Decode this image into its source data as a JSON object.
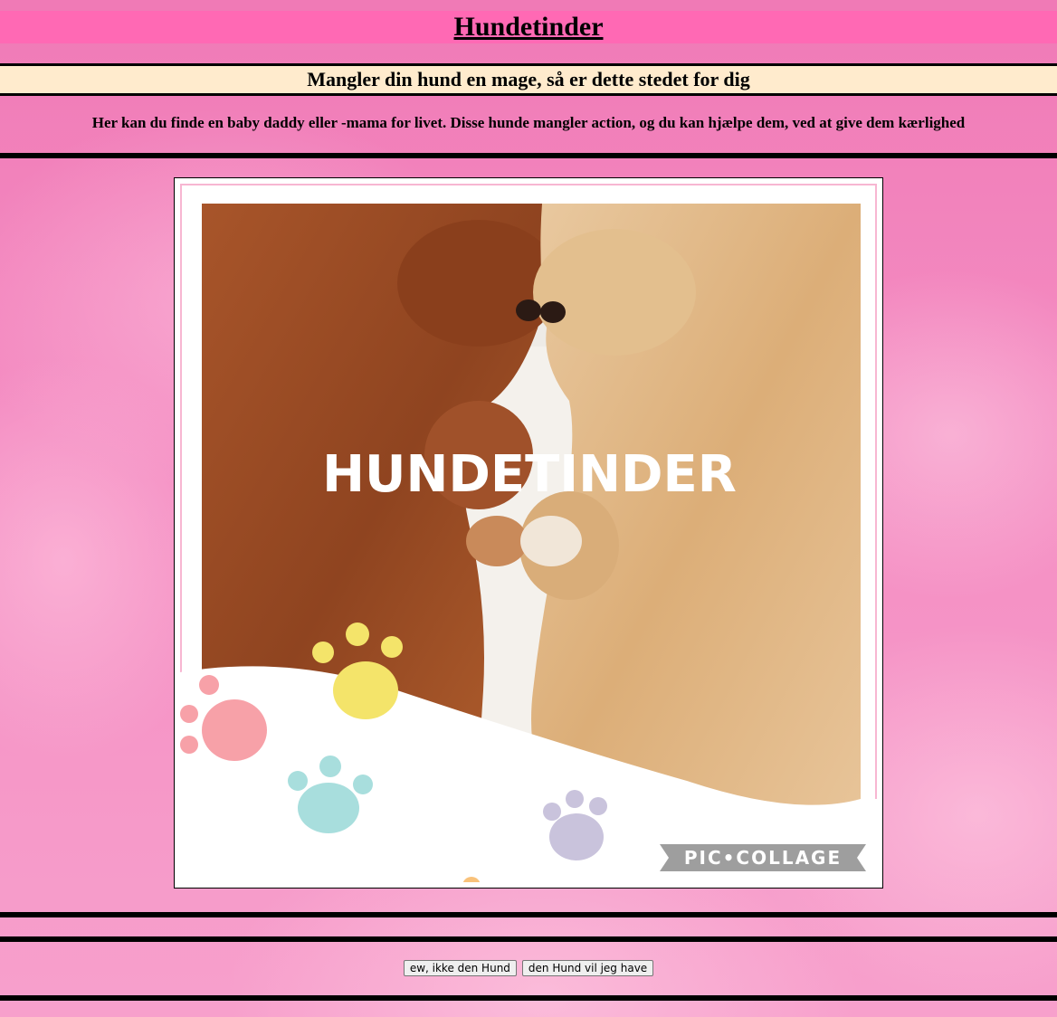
{
  "header": {
    "title": "Hundetinder",
    "subtitle": "Mangler din hund en mage, så er dette stedet for dig",
    "intro": "Her kan du finde en baby daddy eller -mama for livet. Disse hunde mangler action, og du kan hjælpe dem, ved at give dem kærlighed"
  },
  "photo": {
    "overlay_text": "HUNDETINDER",
    "watermark": "PIC•COLLAGE"
  },
  "actions": {
    "reject_label": "ew, ikke den Hund",
    "accept_label": "den Hund vil jeg have"
  },
  "colors": {
    "title_bg": "#ff69b4",
    "subtitle_bg": "#ffebcd",
    "page_bg": "#f48cbf"
  }
}
